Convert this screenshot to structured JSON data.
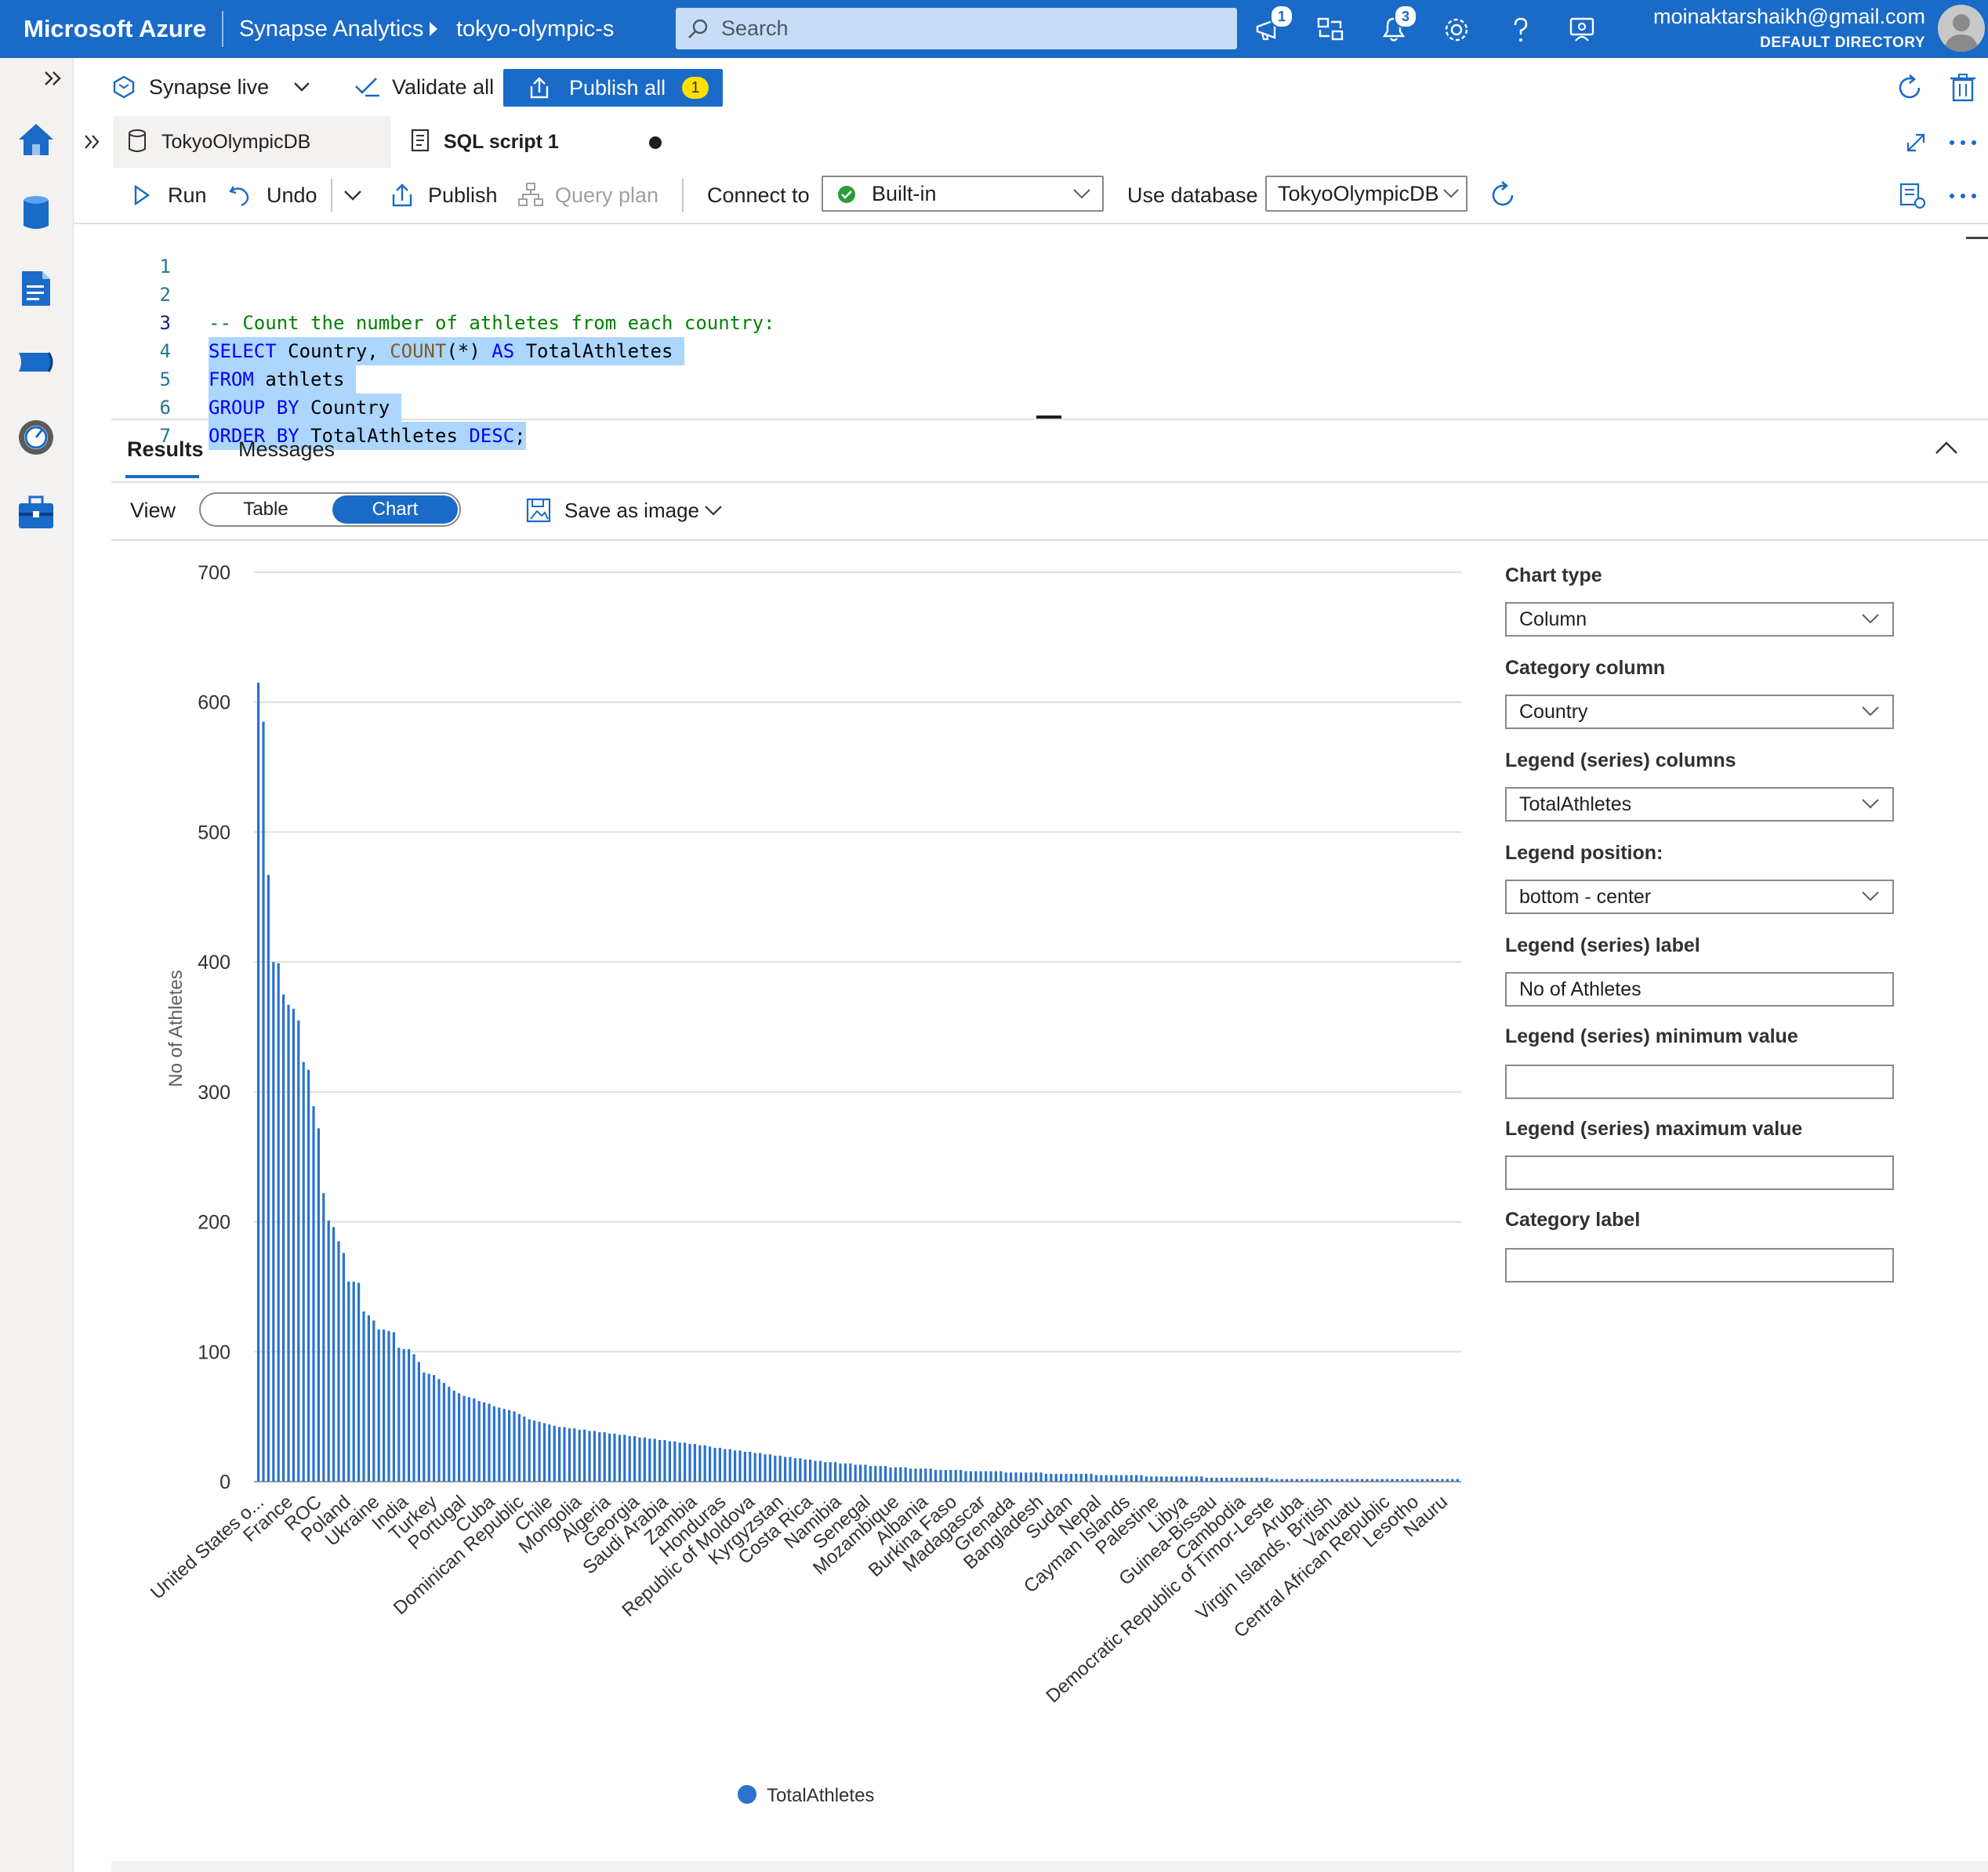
{
  "topbar": {
    "brand": "Microsoft Azure",
    "app": "Synapse Analytics",
    "workspace": "tokyo-olympic-s",
    "search_placeholder": "Search",
    "feedback_badge": "1",
    "notifications_badge": "3",
    "user_email": "moinaktarshaikh@gmail.com",
    "user_directory": "DEFAULT DIRECTORY"
  },
  "toolbar": {
    "mode": "Synapse live",
    "validate_all": "Validate all",
    "publish_all": "Publish all",
    "publish_count": "1"
  },
  "tabs": [
    {
      "label": "TokyoOlympicDB"
    },
    {
      "label": "SQL script 1"
    }
  ],
  "script_toolbar": {
    "run": "Run",
    "undo": "Undo",
    "publish": "Publish",
    "query_plan": "Query plan",
    "connect_to_label": "Connect to",
    "connect_to_value": "Built-in",
    "use_database_label": "Use database",
    "use_database_value": "TokyoOlympicDB"
  },
  "editor": {
    "line_numbers": [
      "1",
      "2",
      "3",
      "4",
      "5",
      "6",
      "7"
    ],
    "comment": "-- Count the number of athletes from each country:",
    "l3_select": "SELECT",
    "l3_country": " Country, ",
    "l3_count": "COUNT",
    "l3_star": "(*) ",
    "l3_as": "AS",
    "l3_alias": " TotalAthletes ",
    "l4_from": "FROM",
    "l4_table": " athlets ",
    "l5_group": "GROUP",
    "l5_by": "BY",
    "l5_col": " Country ",
    "l6_order": "ORDER",
    "l6_by": "BY",
    "l6_col": " TotalAthletes ",
    "l6_desc": "DESC",
    "l6_semi": ";"
  },
  "results": {
    "tab_results": "Results",
    "tab_messages": "Messages",
    "view_label": "View",
    "view_table": "Table",
    "view_chart": "Chart",
    "save_as_image": "Save as image"
  },
  "settings": {
    "chart_type_label": "Chart type",
    "chart_type_value": "Column",
    "category_column_label": "Category column",
    "category_column_value": "Country",
    "legend_series_columns_label": "Legend (series) columns",
    "legend_series_columns_value": "TotalAthletes",
    "legend_position_label": "Legend position:",
    "legend_position_value": "bottom - center",
    "legend_series_label_label": "Legend (series) label",
    "legend_series_label_value": "No of Athletes",
    "legend_min_label": "Legend (series) minimum value",
    "legend_min_value": "",
    "legend_max_label": "Legend (series) maximum value",
    "legend_max_value": "",
    "category_label_label": "Category label",
    "category_label_value": ""
  },
  "chart_data": {
    "type": "bar",
    "ylabel": "No of Athletes",
    "ylim": [
      0,
      700
    ],
    "yticks": [
      0,
      100,
      200,
      300,
      400,
      500,
      600,
      700
    ],
    "grid": true,
    "legend_position": "bottom-center",
    "series": [
      {
        "name": "TotalAthletes",
        "color": "#2b73cd"
      }
    ],
    "tick_labels": [
      "United States o...",
      "France",
      "ROC",
      "Poland",
      "Ukraine",
      "India",
      "Turkey",
      "Portugal",
      "Cuba",
      "Dominican Republic",
      "Chile",
      "Mongolia",
      "Algeria",
      "Georgia",
      "Saudi Arabia",
      "Zambia",
      "Honduras",
      "Republic of Moldova",
      "Kyrgyzstan",
      "Costa Rica",
      "Namibia",
      "Senegal",
      "Mozambique",
      "Albania",
      "Burkina Faso",
      "Madagascar",
      "Grenada",
      "Bangladesh",
      "Sudan",
      "Nepal",
      "Cayman Islands",
      "Palestine",
      "Libya",
      "Guinea-Bissau",
      "Cambodia",
      "Democratic Republic of Timor-Leste",
      "Aruba",
      "Virgin Islands, British",
      "Vanuatu",
      "Central African Republic",
      "Lesotho",
      "Nauru"
    ],
    "values": [
      615,
      585,
      467,
      400,
      399,
      375,
      367,
      364,
      355,
      323,
      317,
      289,
      272,
      222,
      201,
      196,
      185,
      176,
      154,
      154,
      153,
      131,
      128,
      124,
      117,
      117,
      116,
      115,
      103,
      102,
      102,
      98,
      92,
      84,
      83,
      82,
      79,
      76,
      73,
      70,
      68,
      66,
      65,
      64,
      62,
      61,
      60,
      58,
      57,
      56,
      55,
      54,
      52,
      50,
      48,
      47,
      46,
      45,
      44,
      43,
      42,
      42,
      41,
      41,
      40,
      40,
      39,
      39,
      38,
      38,
      37,
      37,
      36,
      36,
      35,
      35,
      34,
      34,
      33,
      33,
      32,
      32,
      31,
      31,
      30,
      30,
      29,
      29,
      28,
      28,
      27,
      26,
      26,
      25,
      25,
      24,
      24,
      23,
      23,
      22,
      22,
      21,
      21,
      20,
      20,
      19,
      19,
      18,
      18,
      17,
      17,
      16,
      16,
      15,
      15,
      15,
      14,
      14,
      14,
      13,
      13,
      13,
      12,
      12,
      12,
      12,
      11,
      11,
      11,
      11,
      10,
      10,
      10,
      10,
      10,
      9,
      9,
      9,
      9,
      9,
      9,
      8,
      8,
      8,
      8,
      8,
      8,
      8,
      8,
      7,
      7,
      7,
      7,
      7,
      7,
      7,
      7,
      6,
      6,
      6,
      6,
      6,
      6,
      6,
      6,
      6,
      6,
      5,
      5,
      5,
      5,
      5,
      5,
      5,
      5,
      5,
      5,
      4,
      4,
      4,
      4,
      4,
      4,
      4,
      4,
      4,
      4,
      4,
      4,
      3,
      3,
      3,
      3,
      3,
      3,
      3,
      3,
      3,
      3,
      3,
      3,
      3,
      2,
      2,
      2,
      2,
      2,
      2,
      2,
      2,
      2,
      2,
      2,
      2,
      2,
      2,
      2,
      2,
      2,
      2,
      2,
      2,
      2,
      2,
      2,
      2,
      2,
      2,
      2,
      2,
      2,
      2,
      2,
      2,
      2,
      2,
      2,
      2,
      2,
      2
    ]
  },
  "colors": {
    "topbar": "#1a6ac8",
    "accent": "#1a6ac8",
    "bar": "#2b73cd",
    "selection": "#add6ff"
  }
}
